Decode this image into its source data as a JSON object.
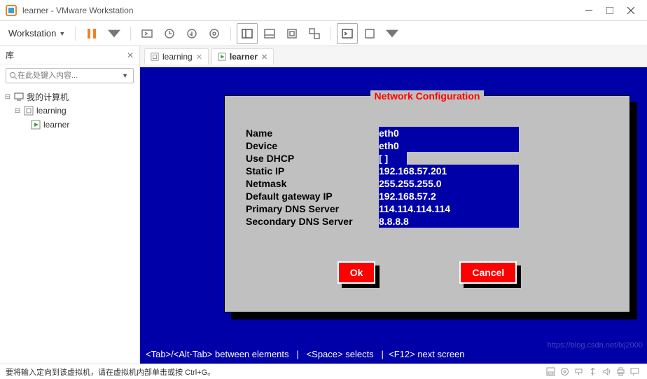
{
  "titlebar": {
    "title": "learner - VMware Workstation"
  },
  "menubar": {
    "workstation_label": "Workstation"
  },
  "sidebar": {
    "header": "库",
    "search_placeholder": "在此处键入内容...",
    "tree": {
      "root": "我的计算机",
      "child1": "learning",
      "child2": "learner"
    }
  },
  "tabs": {
    "tab1": "learning",
    "tab2": "learner"
  },
  "dialog": {
    "title": "Network Configuration",
    "fields": {
      "name_lbl": "Name",
      "name_val": "eth0",
      "device_lbl": "Device",
      "device_val": "eth0",
      "dhcp_lbl": "Use DHCP",
      "dhcp_val": "[ ]",
      "ip_lbl": "Static IP",
      "ip_val": "192.168.57.201",
      "netmask_lbl": "Netmask",
      "netmask_val": "255.255.255.0",
      "gw_lbl": "Default gateway IP",
      "gw_val": "192.168.57.2",
      "dns1_lbl": "Primary DNS Server",
      "dns1_val": "114.114.114.114",
      "dns2_lbl": "Secondary DNS Server",
      "dns2_val": "8.8.8.8"
    },
    "ok": "Ok",
    "cancel": "Cancel",
    "hint": "<Tab>/<Alt-Tab> between elements   |   <Space> selects   |  <F12> next screen"
  },
  "statusbar": {
    "msg": "要将输入定向到该虚拟机，请在虚拟机内部单击或按 Ctrl+G。"
  },
  "watermark": "https://blog.csdn.net/lxj2000"
}
